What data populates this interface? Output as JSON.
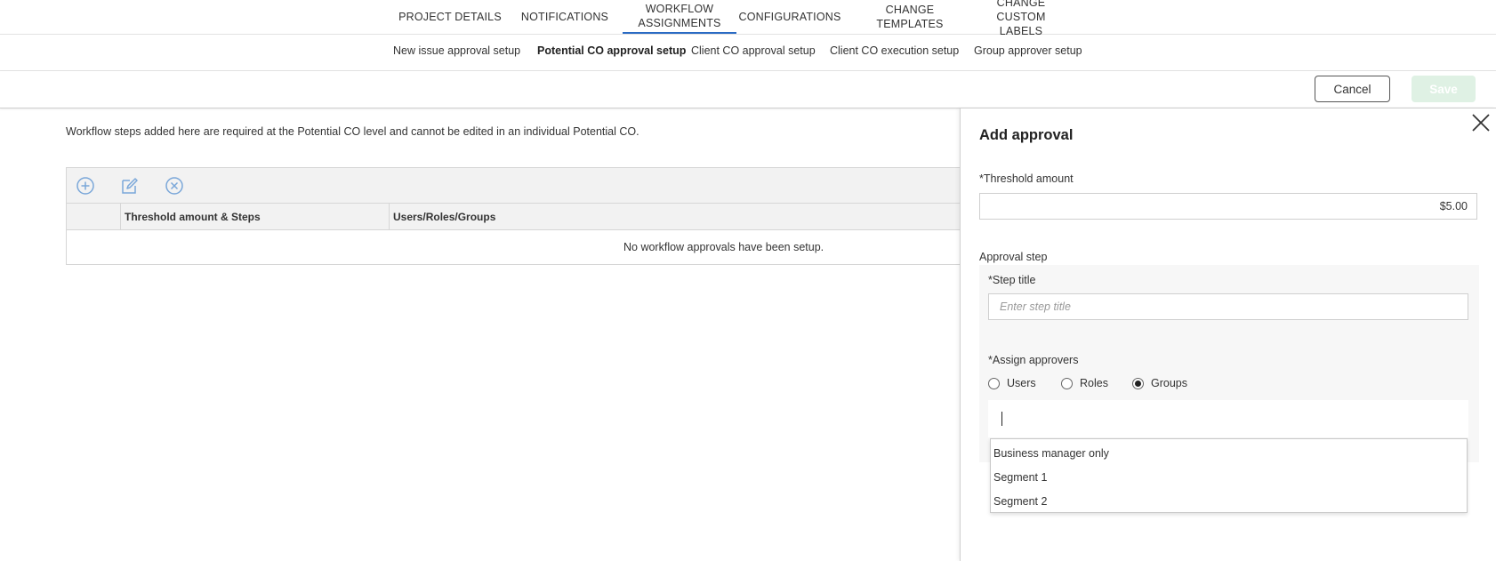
{
  "top_tabs": {
    "items": [
      {
        "label": "PROJECT DETAILS"
      },
      {
        "label": "NOTIFICATIONS"
      },
      {
        "label_line1": "WORKFLOW",
        "label_line2": "ASSIGNMENTS",
        "active": true
      },
      {
        "label": "CONFIGURATIONS"
      },
      {
        "label": "CHANGE TEMPLATES"
      },
      {
        "label_line1": "CHANGE CUSTOM",
        "label_line2": "LABELS"
      }
    ]
  },
  "sub_tabs": {
    "items": [
      {
        "label": "New issue approval setup"
      },
      {
        "label": "Potential CO approval setup",
        "active": true
      },
      {
        "label": "Client CO approval setup"
      },
      {
        "label": "Client CO execution setup"
      },
      {
        "label": "Group approver setup"
      }
    ]
  },
  "actions": {
    "cancel_label": "Cancel",
    "save_label": "Save"
  },
  "main": {
    "info_text": "Workflow steps added here are required at the Potential CO level and cannot be edited in an individual Potential CO.",
    "grid": {
      "toolbar_icons": [
        "add-circle-icon",
        "edit-icon",
        "remove-circle-icon"
      ],
      "columns": [
        "Threshold amount & Steps",
        "Users/Roles/Groups"
      ],
      "empty_message": "No workflow approvals have been setup."
    }
  },
  "panel": {
    "title": "Add approval",
    "threshold_label": "*Threshold amount",
    "threshold_value": "$5.00",
    "approval_step_label": "Approval step",
    "step_title_label": "*Step title",
    "step_title_placeholder": "Enter step title",
    "assign_label": "*Assign approvers",
    "radio_options": [
      {
        "label": "Users",
        "checked": false
      },
      {
        "label": "Roles",
        "checked": false
      },
      {
        "label": "Groups",
        "checked": true
      }
    ],
    "group_options": [
      "Business manager only",
      "Segment 1",
      "Segment 2"
    ]
  },
  "colors": {
    "accent": "#2a6bc4",
    "save_disabled_bg": "#dff1e4",
    "icon_blue": "#7aa7d9"
  }
}
